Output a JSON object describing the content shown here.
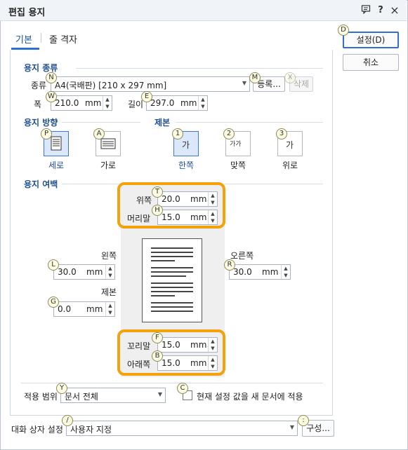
{
  "window": {
    "title": "편집 용지"
  },
  "titlebar_icons": {
    "menu": "message-icon",
    "help": "?",
    "close": "×"
  },
  "tabs": [
    {
      "label": "기본"
    },
    {
      "label": "줄 격자"
    }
  ],
  "buttons": {
    "ok": "설정(D)",
    "cancel": "취소",
    "register": "등록...",
    "delete": "삭제",
    "compose": "구성..."
  },
  "hints": {
    "ok": "D",
    "paper_type": "N",
    "register": "M",
    "delete": "X",
    "width": "W",
    "length": "E",
    "portrait": "P",
    "landscape": "A",
    "binding_one": "1",
    "binding_facing": "2",
    "binding_top": "3",
    "top": "T",
    "header": "H",
    "left": "L",
    "right": "R",
    "gutter": "G",
    "footer": "F",
    "bottom": "B",
    "apply_range": "Y",
    "new_doc_check": "C",
    "dialog_setting": "/",
    "compose": ":"
  },
  "paper_type": {
    "section": "용지 종류",
    "label": "종류",
    "value": "A4(국배판) [210 x 297 mm]",
    "width_label": "폭",
    "width_value": "210.0",
    "width_unit": "mm",
    "length_label": "길이",
    "length_value": "297.0",
    "length_unit": "mm"
  },
  "orientation": {
    "section": "용지 방향",
    "portrait": "세로",
    "landscape": "가로"
  },
  "binding": {
    "section": "제본",
    "one": "한쪽",
    "facing": "맞쪽",
    "top": "위로",
    "glyph": "가",
    "glyph_facing": "가가"
  },
  "margins": {
    "section": "용지 여백",
    "top_label": "위쪽",
    "top_value": "20.0",
    "header_label": "머리말",
    "header_value": "15.0",
    "left_label": "왼쪽",
    "left_value": "30.0",
    "right_label": "오른쪽",
    "right_value": "30.0",
    "gutter_label": "제본",
    "gutter_value": "0.0",
    "footer_label": "꼬리말",
    "footer_value": "15.0",
    "bottom_label": "아래쪽",
    "bottom_value": "15.0",
    "unit": "mm"
  },
  "apply": {
    "label": "적용 범위",
    "value": "문서 전체",
    "checkbox_label": "현재 설정 값을 새 문서에 적용",
    "checked": false
  },
  "dialog_setting": {
    "label": "대화 상자 설정",
    "value": "사용자 지정"
  },
  "colors": {
    "accent": "#2e6fd1",
    "highlight": "#f4a20b",
    "section_title": "#1d4f91"
  }
}
